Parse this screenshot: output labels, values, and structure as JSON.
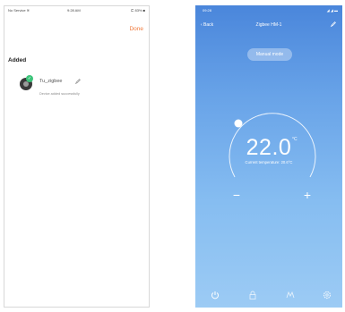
{
  "left_screen": {
    "status_bar": {
      "carrier": "No Service ≋",
      "time": "9:28 AM",
      "battery": "⊏ 83% ■"
    },
    "done_label": "Done",
    "added_title": "Added",
    "device": {
      "name": "Tu_zigbee",
      "status": "Device added successfully",
      "icon": "thermostat-device-icon"
    }
  },
  "right_screen": {
    "status_bar": {
      "time": "09:28",
      "signal": "◢ ◢ ▬"
    },
    "nav": {
      "back_label": "‹ Back",
      "title": "Zigbee HM-1"
    },
    "mode_label": "Manual mode",
    "temperature": {
      "value": "22.0",
      "unit": "°C",
      "current_label": "Current temperature: 20.6°C"
    },
    "controls": {
      "minus": "−",
      "plus": "+"
    },
    "tabs": [
      "power-icon",
      "lock-icon",
      "mode-icon",
      "settings-icon"
    ],
    "colors": {
      "gradient_top": "#4a86db",
      "gradient_bottom": "#9ccbf4",
      "accent": "#f07a3c",
      "check": "#3cc47a"
    }
  }
}
